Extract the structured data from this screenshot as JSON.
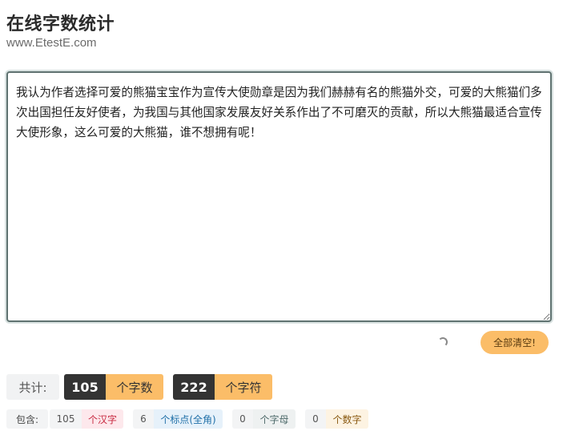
{
  "header": {
    "title": "在线字数统计",
    "subtitle": "www.EtestE.com"
  },
  "editor": {
    "text": "我认为作者选择可爱的熊猫宝宝作为宣传大使勋章是因为我们赫赫有名的熊猫外交，可爱的大熊猫们多次出国担任友好使者，为我国与其他国家发展友好关系作出了不可磨灭的贡献，所以大熊猫最适合宣传大使形象，这么可爱的大熊猫，谁不想拥有呢！"
  },
  "actions": {
    "clear_label": "全部清空!"
  },
  "totals": {
    "label": "共计:",
    "chars_value": "105",
    "chars_unit": "个字数",
    "symbols_value": "222",
    "symbols_unit": "个字符"
  },
  "breakdown": {
    "label": "包含:",
    "han_value": "105",
    "han_unit": "个汉字",
    "punct_value": "6",
    "punct_unit": "个标点(全角)",
    "letter_value": "0",
    "letter_unit": "个字母",
    "digit_value": "0",
    "digit_unit": "个数字"
  },
  "icons": {
    "spinner": "loading-spinner-icon"
  },
  "colors": {
    "accent": "#fbbd68",
    "dark": "#333333",
    "border": "#5f7270"
  }
}
